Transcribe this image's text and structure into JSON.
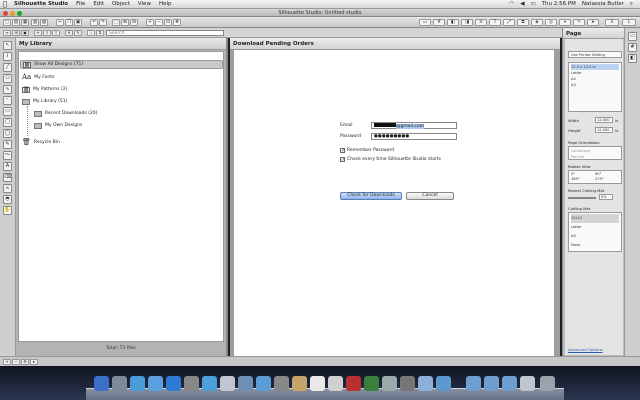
{
  "menubar": {
    "app": "Silhouette Studio",
    "items": [
      "File",
      "Edit",
      "Object",
      "View",
      "Help"
    ],
    "clock": "Thu 2:56 PM",
    "user": "Natassia Butler"
  },
  "window": {
    "title": "Silhouette Studio: Untitled studio"
  },
  "search": {
    "placeholder": "Search"
  },
  "library": {
    "title": "My Library",
    "items": [
      {
        "label": "Show All Designs (71)"
      },
      {
        "label": "My Fonts"
      },
      {
        "label": "My Patterns (2)"
      },
      {
        "label": "My Library (51)"
      },
      {
        "label": "Recent Downloads (20)"
      },
      {
        "label": "My Own Designs"
      },
      {
        "label": "Recycle Bin"
      }
    ],
    "footer": "Total: 73 files"
  },
  "download": {
    "title": "Download Pending Orders",
    "email_label": "Email",
    "email_value": "@gmail.com",
    "password_label": "Password",
    "password_value": "●●●●●●●●●",
    "remember_label": "Remember Password",
    "check_label": "Check every time Silhouette Studio starts",
    "check_button": "Check for Downloads",
    "cancel_button": "Cancel"
  },
  "page_panel": {
    "title": "Page",
    "printer_setting": "Use Printer Setting",
    "media_sizes": [
      "12.0 x 12.0 in",
      "Letter",
      "A4",
      "A3"
    ],
    "width_label": "Width",
    "width_value": "12.000",
    "height_label": "Height",
    "height_value": "12.000",
    "unit": "in",
    "orientation_label": "Page Orientation",
    "orientations": [
      "Landscape",
      "Portrait"
    ],
    "rotate_label": "Rotate View",
    "rotations": [
      "0°",
      "90°",
      "180°",
      "270°"
    ],
    "reveal_label": "Reveal Cutting Mat",
    "reveal_value": "0%",
    "cutting_mat_label": "Cutting Mat",
    "cutting_mats": [
      "12x12",
      "Letter",
      "A4",
      "None"
    ],
    "advanced": "Advanced Options"
  },
  "colors": {
    "accent": "#8fb6ea",
    "dock": "#2a3550"
  }
}
